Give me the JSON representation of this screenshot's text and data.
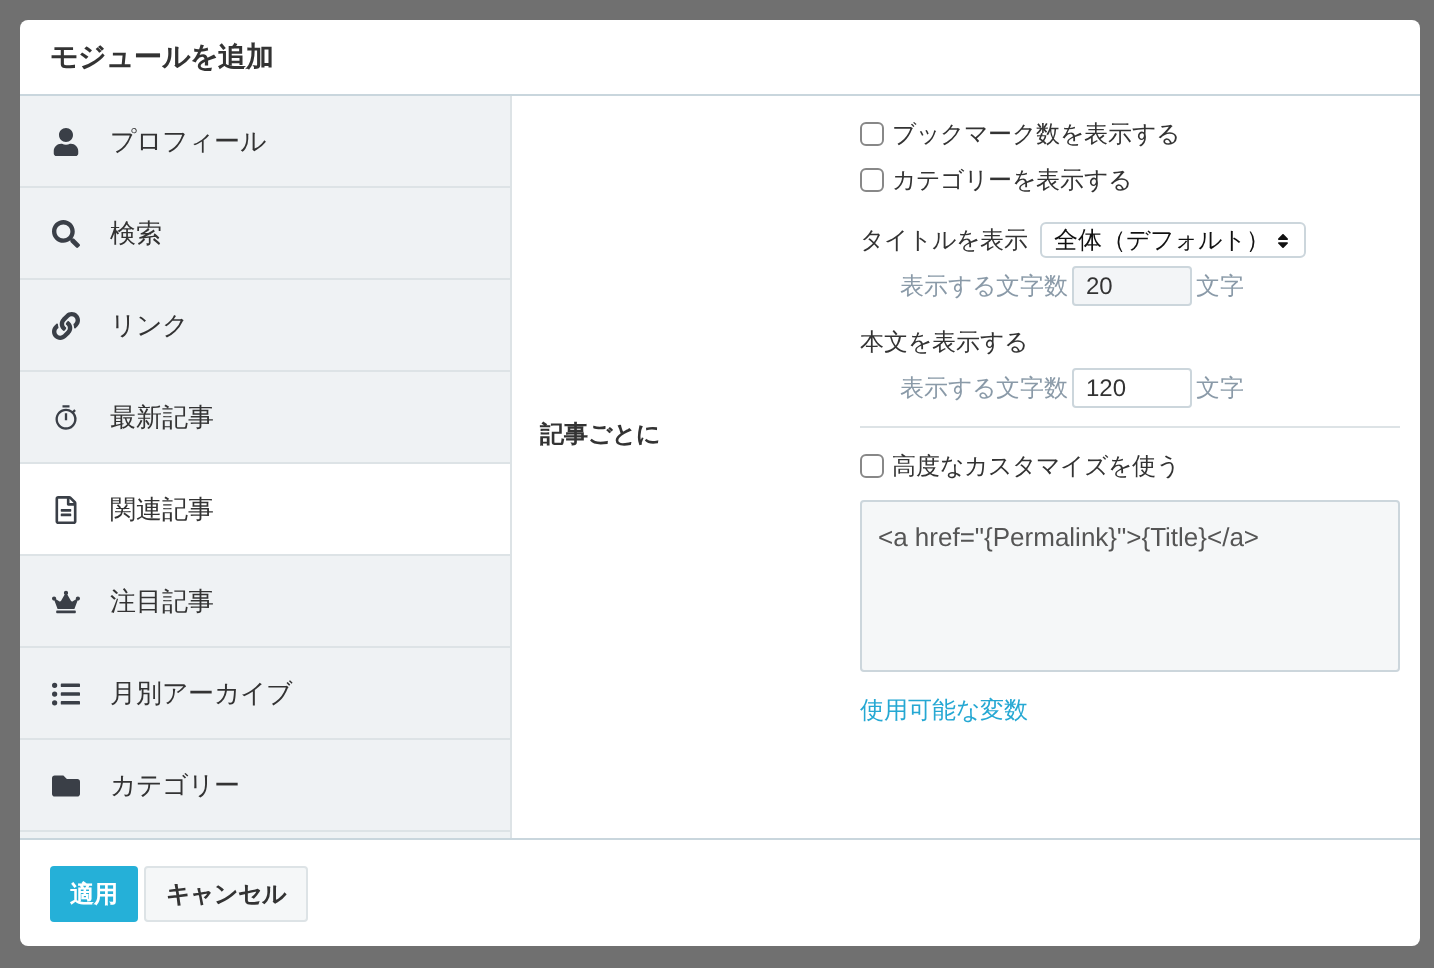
{
  "dialog": {
    "title": "モジュールを追加"
  },
  "sidebar": {
    "items": [
      {
        "label": "プロフィール",
        "selected": false
      },
      {
        "label": "検索",
        "selected": false
      },
      {
        "label": "リンク",
        "selected": false
      },
      {
        "label": "最新記事",
        "selected": false
      },
      {
        "label": "関連記事",
        "selected": true
      },
      {
        "label": "注目記事",
        "selected": false
      },
      {
        "label": "月別アーカイブ",
        "selected": false
      },
      {
        "label": "カテゴリー",
        "selected": false
      }
    ]
  },
  "form": {
    "section_label": "記事ごとに",
    "checkboxes": [
      {
        "label": "ブックマーク数を表示する",
        "checked": false
      },
      {
        "label": "カテゴリーを表示する",
        "checked": false
      }
    ],
    "title_setting": {
      "label": "タイトルを表示",
      "select_value": "全体（デフォルト）",
      "count_label": "表示する文字数",
      "count_value": "20",
      "count_disabled": true,
      "unit": "文字"
    },
    "body_setting": {
      "label": "本文を表示する",
      "count_label": "表示する文字数",
      "count_value": "120",
      "count_disabled": false,
      "unit": "文字"
    },
    "advanced": {
      "label": "高度なカスタマイズを使う",
      "checked": false,
      "template": "<a href=\"{Permalink}\">{Title}</a>",
      "link": "使用可能な変数"
    }
  },
  "buttons": [
    {
      "kind": "primary",
      "label": "適用"
    },
    {
      "kind": "secondary",
      "label": "キャンセル"
    }
  ]
}
